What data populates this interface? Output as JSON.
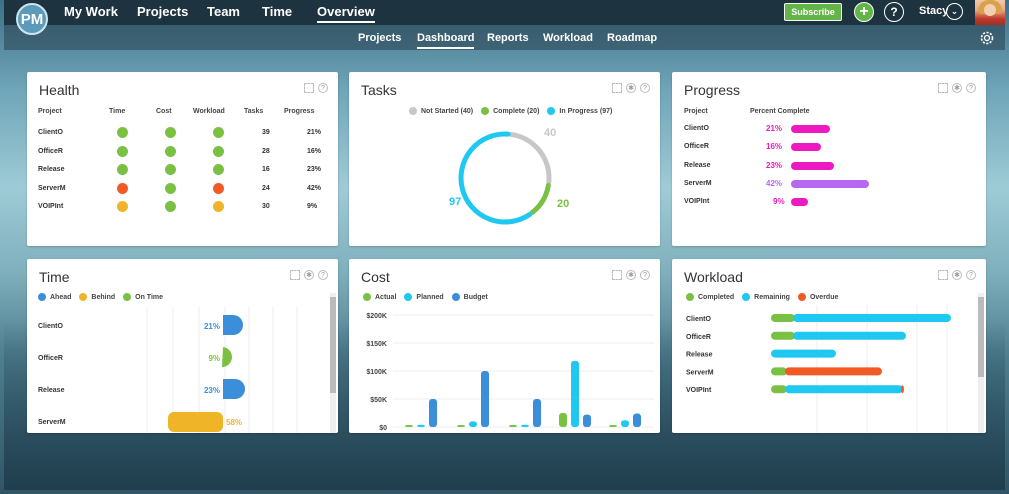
{
  "app": {
    "logo": "PM"
  },
  "nav": {
    "items": [
      "My Work",
      "Projects",
      "Team",
      "Time",
      "Overview"
    ],
    "active": "Overview"
  },
  "subnav": {
    "items": [
      "Projects",
      "Dashboard",
      "Reports",
      "Workload",
      "Roadmap"
    ],
    "active": "Dashboard"
  },
  "header": {
    "subscribe_label": "Subscribe",
    "plus_glyph": "+",
    "help_glyph": "?",
    "user_name": "Stacy",
    "chevron_glyph": "⌄"
  },
  "colors": {
    "green": "#7ac143",
    "orange": "#f15a24",
    "yellow": "#f0b429",
    "magenta": "#ec1ac0",
    "purple": "#b667f1",
    "cyan": "#1ec8f0",
    "blue": "#3b8ed9",
    "grey": "#c7c7c7"
  },
  "health": {
    "title": "Health",
    "headers": [
      "Project",
      "Time",
      "Cost",
      "Workload",
      "Tasks",
      "Progress"
    ],
    "rows": [
      {
        "project": "ClientO",
        "time": "green",
        "cost": "green",
        "workload": "green",
        "tasks": "39",
        "progress": "21%"
      },
      {
        "project": "OfficeR",
        "time": "green",
        "cost": "green",
        "workload": "green",
        "tasks": "28",
        "progress": "16%"
      },
      {
        "project": "Release",
        "time": "green",
        "cost": "green",
        "workload": "green",
        "tasks": "16",
        "progress": "23%"
      },
      {
        "project": "ServerM",
        "time": "orange",
        "cost": "green",
        "workload": "orange",
        "tasks": "24",
        "progress": "42%"
      },
      {
        "project": "VOIPInt",
        "time": "yellow",
        "cost": "green",
        "workload": "yellow",
        "tasks": "30",
        "progress": "9%"
      }
    ]
  },
  "tasks": {
    "title": "Tasks",
    "legend": [
      "Not Started (40)",
      "Complete (20)",
      "In Progress (97)"
    ],
    "chart_data": {
      "type": "pie",
      "categories": [
        "Not Started",
        "Complete",
        "In Progress"
      ],
      "values": [
        40,
        20,
        97
      ],
      "labels": [
        "40",
        "20",
        "97"
      ]
    }
  },
  "progress": {
    "title": "Progress",
    "headers": [
      "Project",
      "Percent Complete"
    ],
    "chart_data": {
      "type": "bar",
      "categories": [
        "ClientO",
        "OfficeR",
        "Release",
        "ServerM",
        "VOIPInt"
      ],
      "values": [
        21,
        16,
        23,
        42,
        9
      ],
      "labels": [
        "21%",
        "16%",
        "23%",
        "42%",
        "9%"
      ]
    }
  },
  "time": {
    "title": "Time",
    "legend": [
      "Ahead",
      "Behind",
      "On Time"
    ],
    "chart_data": {
      "type": "bar",
      "categories": [
        "ClientO",
        "OfficeR",
        "Release",
        "ServerM"
      ],
      "values": [
        21,
        9,
        23,
        58
      ],
      "status": [
        "Ahead",
        "On Time",
        "Ahead",
        "Behind"
      ],
      "labels": [
        "21%",
        "9%",
        "23%",
        "58%"
      ]
    }
  },
  "cost": {
    "title": "Cost",
    "legend": [
      "Actual",
      "Planned",
      "Budget"
    ],
    "chart_data": {
      "type": "bar",
      "ylabels": [
        "$200K",
        "$150K",
        "$100K",
        "$50K",
        "$0"
      ],
      "ylim": [
        0,
        200000
      ],
      "series": [
        {
          "name": "Actual",
          "values": [
            3000,
            2000,
            2000,
            25000,
            3000
          ]
        },
        {
          "name": "Planned",
          "values": [
            4000,
            10000,
            4000,
            118000,
            12000
          ]
        },
        {
          "name": "Budget",
          "values": [
            50000,
            100000,
            50000,
            22000,
            24000
          ]
        }
      ]
    }
  },
  "workload": {
    "title": "Workload",
    "legend": [
      "Completed",
      "Remaining",
      "Overdue"
    ],
    "chart_data": {
      "type": "bar",
      "categories": [
        "ClientO",
        "OfficeR",
        "Release",
        "ServerM",
        "VOIPInt"
      ],
      "series": [
        {
          "name": "Completed",
          "values": [
            24,
            24,
            0,
            16,
            16
          ]
        },
        {
          "name": "Remaining",
          "values": [
            158,
            113,
            65,
            0,
            118
          ]
        },
        {
          "name": "Overdue",
          "values": [
            0,
            0,
            0,
            97,
            3
          ]
        }
      ]
    }
  }
}
